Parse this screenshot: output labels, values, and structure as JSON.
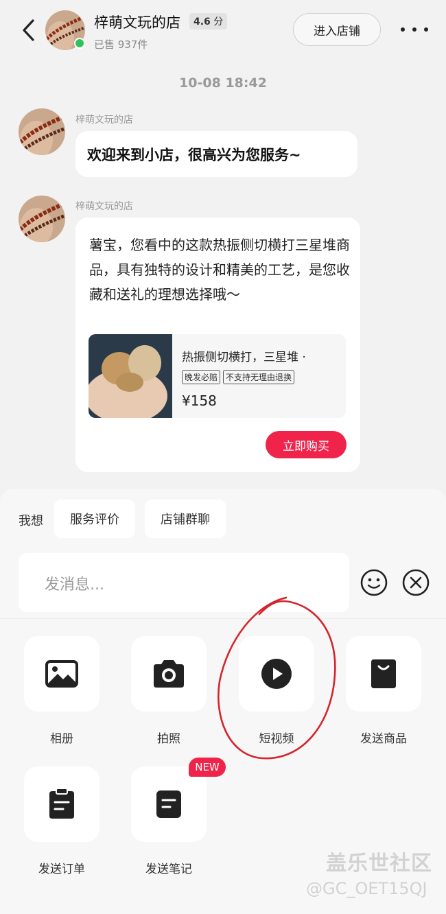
{
  "header": {
    "shop_name": "梓萌文玩的店",
    "rating": "4.6",
    "rating_unit": "分",
    "sold": "已售 937件",
    "enter_shop": "进入店铺"
  },
  "timestamp": "10-08 18:42",
  "messages": [
    {
      "sender": "梓萌文玩的店",
      "text": "欢迎来到小店，很高兴为您服务~"
    },
    {
      "sender": "梓萌文玩的店",
      "text": "薯宝，您看中的这款热振侧切横打三星堆商品，具有独特的设计和精美的工艺，是您收藏和送礼的理想选择哦～"
    }
  ],
  "product": {
    "title": "热振侧切横打，三星堆 ·",
    "tags": [
      "晚发必赔",
      "不支持无理由退换"
    ],
    "price": "¥158",
    "buy": "立即购买"
  },
  "quick": {
    "label": "我想",
    "chips": [
      "服务评价",
      "店铺群聊"
    ]
  },
  "input": {
    "placeholder": "发消息..."
  },
  "tools": [
    {
      "label": "相册",
      "icon": "album-icon"
    },
    {
      "label": "拍照",
      "icon": "camera-icon"
    },
    {
      "label": "短视频",
      "icon": "video-play-icon"
    },
    {
      "label": "发送商品",
      "icon": "shopping-bag-icon"
    },
    {
      "label": "发送订单",
      "icon": "order-clipboard-icon"
    },
    {
      "label": "发送笔记",
      "icon": "note-icon"
    }
  ],
  "new_badge": "NEW",
  "watermark": {
    "line1": "盖乐世社区",
    "line2": "@GC_OET15QJ"
  },
  "colors": {
    "accent": "#f0244b",
    "online": "#2fc25b",
    "background": "#f2f2f2"
  }
}
